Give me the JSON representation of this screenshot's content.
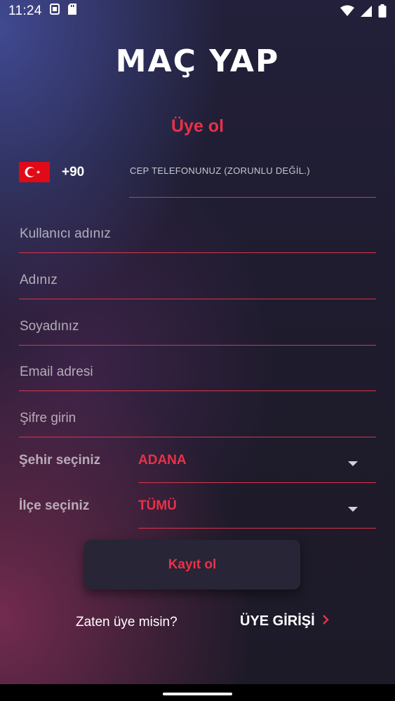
{
  "status_bar": {
    "time": "11:24",
    "icons_left": [
      "sim-card-icon",
      "sd-card-icon"
    ],
    "icons_right": [
      "wifi-icon",
      "signal-icon",
      "battery-icon"
    ]
  },
  "logo": {
    "text": "MAÇ YAP"
  },
  "form": {
    "title": "Üye ol",
    "country": {
      "flag": "turkey-flag-icon",
      "code": "+90"
    },
    "phone_placeholder": "CEP TELEFONUNUZ (ZORUNLU DEĞİL.)",
    "username_placeholder": "Kullanıcı adınız",
    "first_name_placeholder": "Adınız",
    "last_name_placeholder": "Soyadınız",
    "email_placeholder": "Email adresi",
    "password_placeholder": "Şifre girin",
    "city": {
      "label": "Şehir seçiniz",
      "value": "ADANA"
    },
    "district": {
      "label": "İlçe seçiniz",
      "value": "TÜMÜ"
    },
    "submit_label": "Kayıt ol"
  },
  "footer": {
    "already_member": "Zaten üye misin?",
    "login_label": "ÜYE GİRİŞİ"
  },
  "colors": {
    "accent": "#e8314a",
    "underline": "#d7354a",
    "button_bg": "#272536"
  }
}
